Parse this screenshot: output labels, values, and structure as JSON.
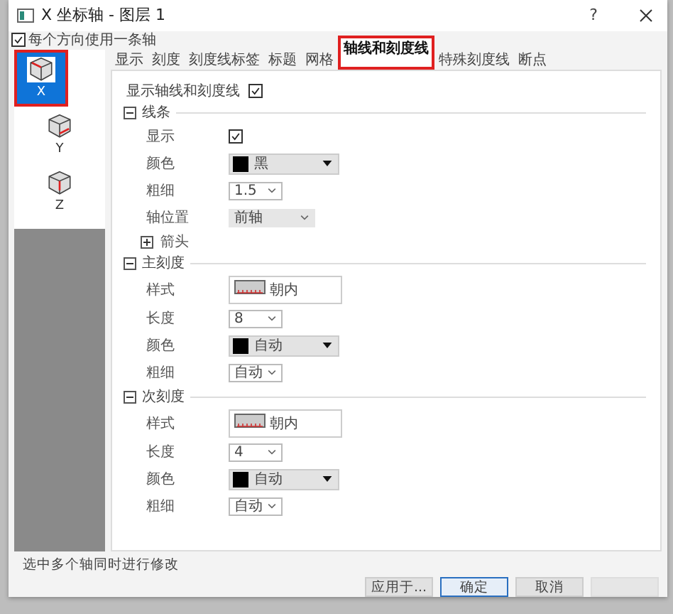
{
  "window": {
    "title": "X 坐标轴 - 图层 1",
    "help": "?"
  },
  "one_axis_per_direction": {
    "label": "每个方向使用一条轴",
    "checked": true
  },
  "axes": [
    {
      "label": "X",
      "selected": true,
      "highlighted": true
    },
    {
      "label": "Y",
      "selected": false,
      "highlighted": false
    },
    {
      "label": "Z",
      "selected": false,
      "highlighted": false
    }
  ],
  "tabs": [
    {
      "label": "显示",
      "selected": false,
      "highlighted": false
    },
    {
      "label": "刻度",
      "selected": false,
      "highlighted": false
    },
    {
      "label": "刻度线标签",
      "selected": false,
      "highlighted": false
    },
    {
      "label": "标题",
      "selected": false,
      "highlighted": false
    },
    {
      "label": "网格",
      "selected": false,
      "highlighted": false
    },
    {
      "label": "轴线和刻度线",
      "selected": true,
      "highlighted": true
    },
    {
      "label": "特殊刻度线",
      "selected": false,
      "highlighted": false
    },
    {
      "label": "断点",
      "selected": false,
      "highlighted": false
    }
  ],
  "show_axis": {
    "label": "显示轴线和刻度线",
    "checked": true
  },
  "sections": [
    {
      "title": "线条",
      "expanded": true,
      "rows": [
        {
          "kind": "check",
          "label": "显示",
          "checked": true
        },
        {
          "kind": "color",
          "label": "颜色",
          "value": "黑",
          "color": "#000000"
        },
        {
          "kind": "select",
          "label": "粗细",
          "value": "1.5"
        },
        {
          "kind": "flat",
          "label": "轴位置",
          "value": "前轴"
        },
        {
          "kind": "group",
          "label": "箭头",
          "expanded": false
        }
      ]
    },
    {
      "title": "主刻度",
      "expanded": true,
      "rows": [
        {
          "kind": "style",
          "label": "样式",
          "value": "朝内"
        },
        {
          "kind": "select",
          "label": "长度",
          "value": "8"
        },
        {
          "kind": "color",
          "label": "颜色",
          "value": "自动",
          "color": "#000000"
        },
        {
          "kind": "select",
          "label": "粗细",
          "value": "自动"
        }
      ]
    },
    {
      "title": "次刻度",
      "expanded": true,
      "rows": [
        {
          "kind": "style",
          "label": "样式",
          "value": "朝内"
        },
        {
          "kind": "select",
          "label": "长度",
          "value": "4"
        },
        {
          "kind": "color",
          "label": "颜色",
          "value": "自动",
          "color": "#000000"
        },
        {
          "kind": "select",
          "label": "粗细",
          "value": "自动"
        }
      ]
    }
  ],
  "status": "选中多个轴同时进行修改",
  "buttons": [
    {
      "label": "应用于...",
      "default": false,
      "disabled": false
    },
    {
      "label": "确定",
      "default": true,
      "disabled": false
    },
    {
      "label": "取消",
      "default": false,
      "disabled": false
    },
    {
      "default": false,
      "disabled": true
    }
  ]
}
